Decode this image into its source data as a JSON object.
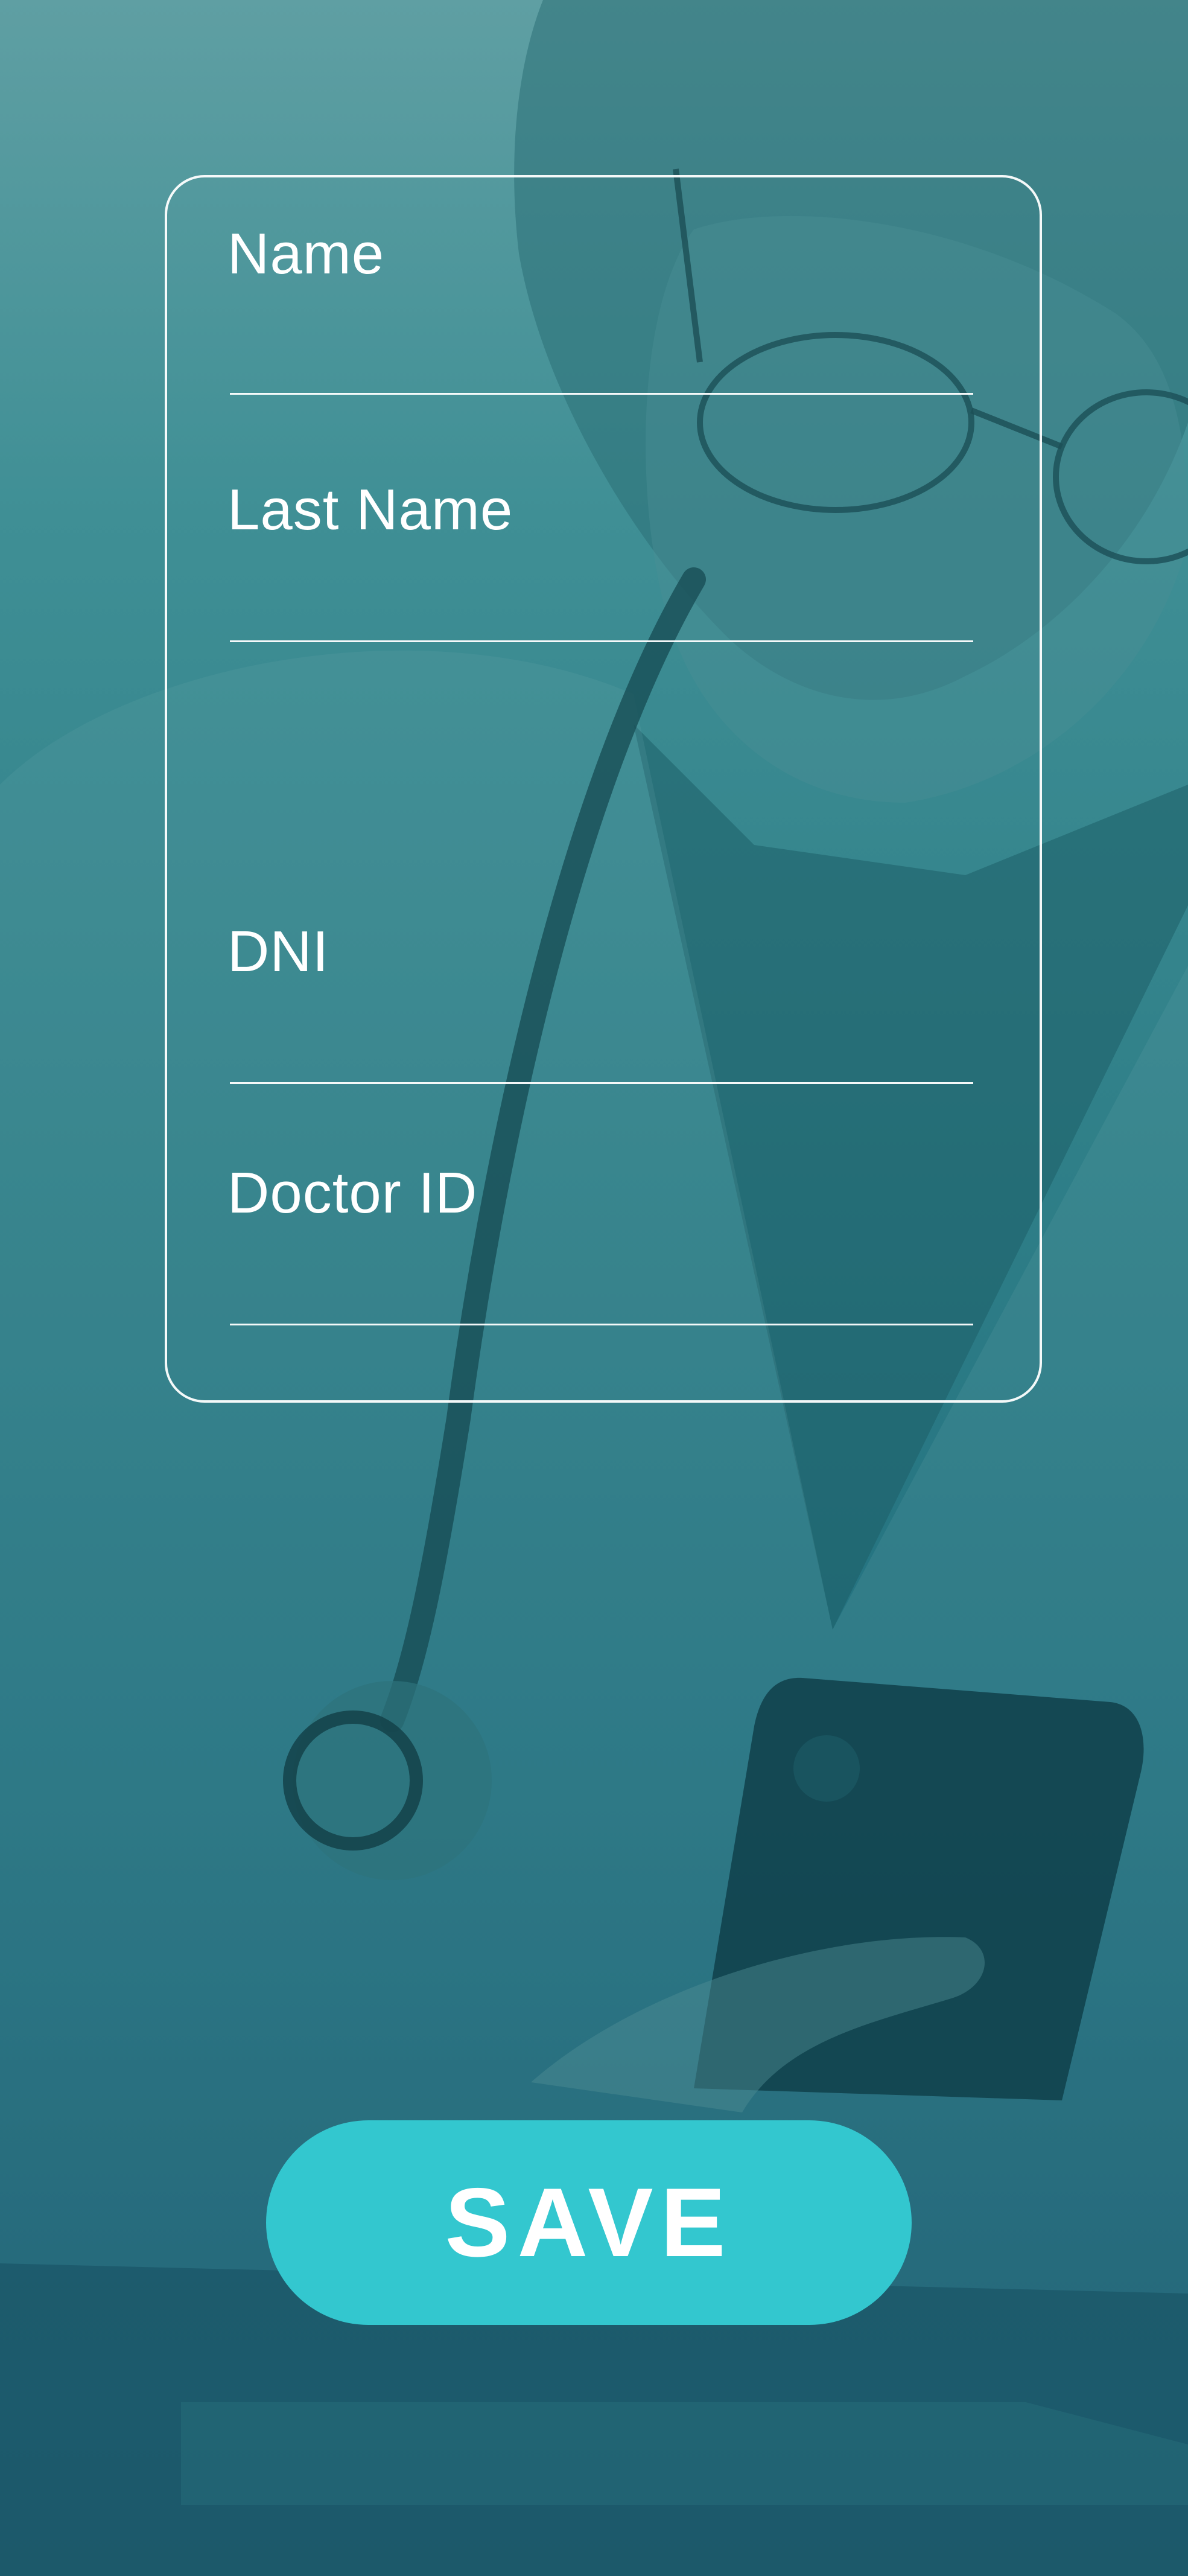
{
  "form": {
    "fields": [
      {
        "label": "Name",
        "value": "",
        "placeholder": ""
      },
      {
        "label": "Last Name",
        "value": "",
        "placeholder": ""
      },
      {
        "label": "DNI",
        "value": "",
        "placeholder": ""
      },
      {
        "label": "Doctor ID",
        "value": "",
        "placeholder": ""
      }
    ]
  },
  "actions": {
    "save_label": "SAVE"
  },
  "colors": {
    "overlay_teal": "#2f7f88",
    "accent_button": "#33c7cf",
    "text": "#ffffff"
  },
  "background": {
    "subject": "doctor-with-stethoscope-using-phone-photo"
  }
}
